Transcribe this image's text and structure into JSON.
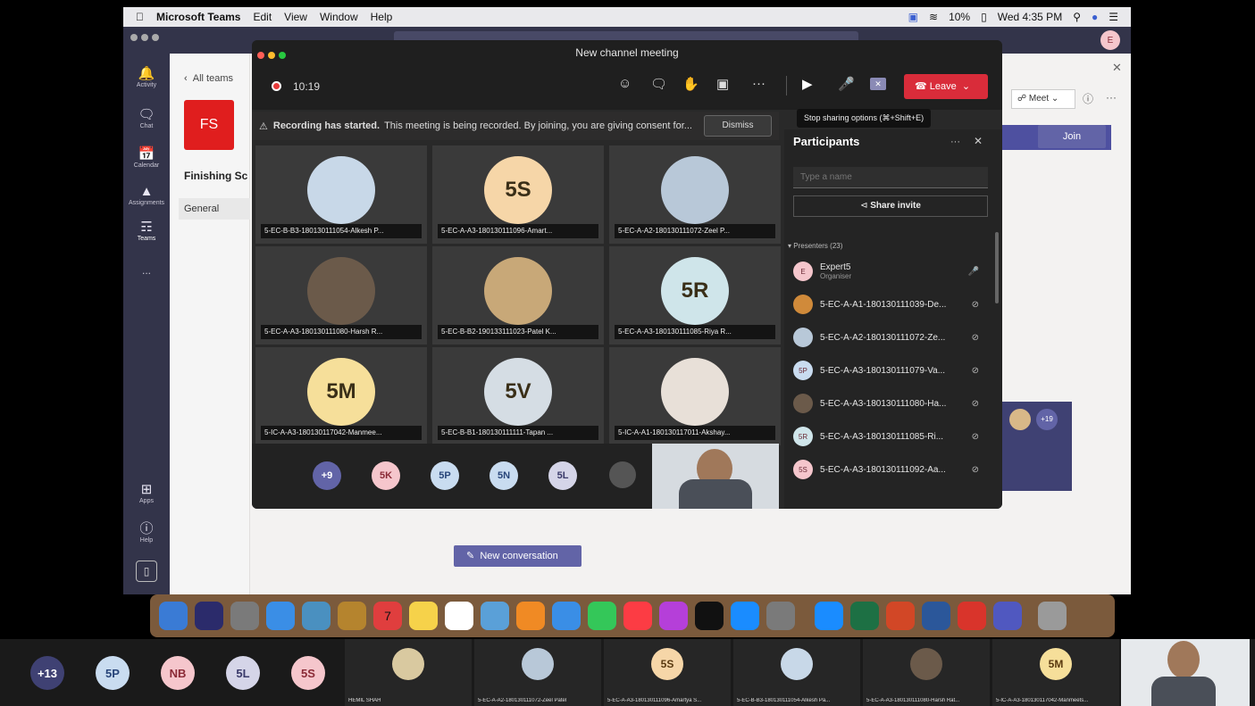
{
  "menubar": {
    "app_name": "Microsoft Teams",
    "menus": [
      "Edit",
      "View",
      "Window",
      "Help"
    ],
    "battery": "10%",
    "clock": "Wed 4:35 PM"
  },
  "rail": [
    {
      "label": "Activity",
      "icon": "bell-icon"
    },
    {
      "label": "Chat",
      "icon": "chat-icon"
    },
    {
      "label": "Calendar",
      "icon": "calendar-icon"
    },
    {
      "label": "Assignments",
      "icon": "assignments-icon"
    },
    {
      "label": "Teams",
      "icon": "teams-icon"
    },
    {
      "label": "...",
      "icon": "more-icon"
    },
    {
      "label": "Apps",
      "icon": "apps-icon"
    },
    {
      "label": "Help",
      "icon": "help-icon"
    }
  ],
  "team_panel": {
    "back_label": "All teams",
    "team_initials": "FS",
    "team_name": "Finishing Sc",
    "channel": "General",
    "meet_label": "Meet",
    "join_label": "Join",
    "new_conversation": "New conversation",
    "plus_count": "+19"
  },
  "meeting": {
    "title": "New channel meeting",
    "timer": "10:19",
    "leave_label": "Leave",
    "tooltip": "Stop sharing options (⌘+Shift+E)",
    "banner_bold": "Recording has started.",
    "banner_text": "This meeting is being recorded. By joining, you are giving consent for...",
    "dismiss_label": "Dismiss",
    "tiles": [
      {
        "name": "5-EC-B-B3-180130111054-Alkesh P...",
        "initials": "",
        "color": "#c8d8e8"
      },
      {
        "name": "5-EC-A-A3-180130111096-Amart...",
        "initials": "5S",
        "color": "#f6d6a8"
      },
      {
        "name": "5-EC-A-A2-180130111072-Zeel P...",
        "initials": "",
        "color": "#b8c8d8"
      },
      {
        "name": "5-EC-A-A3-180130111080-Harsh R...",
        "initials": "",
        "color": "#6b5a4a"
      },
      {
        "name": "5-EC-B-B2-190133111023-Patel K...",
        "initials": "",
        "color": "#c8a878"
      },
      {
        "name": "5-EC-A-A3-180130111085-Riya R...",
        "initials": "5R",
        "color": "#cfe5ea"
      },
      {
        "name": "5-IC-A-A3-180130117042-Manmee...",
        "initials": "5M",
        "color": "#f6df9a"
      },
      {
        "name": "5-EC-B-B1-180130111111-Tapan ...",
        "initials": "5V",
        "color": "#d5dde4"
      },
      {
        "name": "5-IC-A-A1-180130117011-Akshay...",
        "initials": "",
        "color": "#e8e0d8"
      }
    ],
    "bottom_chips": [
      {
        "label": "+9",
        "bg": "#6264a7",
        "fg": "#ffffff"
      },
      {
        "label": "5K",
        "bg": "#f5c6cc",
        "fg": "#8a2a36"
      },
      {
        "label": "5P",
        "bg": "#c9dcf0",
        "fg": "#28457a"
      },
      {
        "label": "5N",
        "bg": "#c9dcf0",
        "fg": "#28457a"
      },
      {
        "label": "5L",
        "bg": "#d5d5e8",
        "fg": "#3a3a6a"
      }
    ]
  },
  "participants": {
    "title": "Participants",
    "search_placeholder": "Type a name",
    "share_invite": "Share invite",
    "section": "Presenters (23)",
    "people": [
      {
        "name": "Expert5",
        "sub": "Organiser",
        "initials": "E",
        "bg": "#f5c6cc"
      },
      {
        "name": "5-EC-A-A1-180130111039-De...",
        "sub": "",
        "initials": "",
        "bg": "#d08a3a"
      },
      {
        "name": "5-EC-A-A2-180130111072-Ze...",
        "sub": "",
        "initials": "",
        "bg": "#b8c8d8"
      },
      {
        "name": "5-EC-A-A3-180130111079-Va...",
        "sub": "",
        "initials": "5P",
        "bg": "#c9dcf0"
      },
      {
        "name": "5-EC-A-A3-180130111080-Ha...",
        "sub": "",
        "initials": "",
        "bg": "#6b5a4a"
      },
      {
        "name": "5-EC-A-A3-180130111085-Ri...",
        "sub": "",
        "initials": "5R",
        "bg": "#cfe5ea"
      },
      {
        "name": "5-EC-A-A3-180130111092-Aa...",
        "sub": "",
        "initials": "5S",
        "bg": "#f5c6cc"
      }
    ]
  },
  "dock_calendar_day": "7",
  "bottom_strip": {
    "chips": [
      {
        "label": "+13",
        "bg": "#3f4173",
        "fg": "#ffffff"
      },
      {
        "label": "5P",
        "bg": "#c9dcf0",
        "fg": "#28457a"
      },
      {
        "label": "NB",
        "bg": "#f5c6cc",
        "fg": "#8a2a36"
      },
      {
        "label": "5L",
        "bg": "#d5d5e8",
        "fg": "#3a3a6a"
      },
      {
        "label": "5S",
        "bg": "#f5c6cc",
        "fg": "#8a2a36"
      }
    ],
    "tiles": [
      {
        "name": "HEMIL SHAH",
        "initials": "",
        "bg": "#d9c9a0"
      },
      {
        "name": "5-EC-A-A2-180130111072-Zeel Patel",
        "initials": "",
        "bg": "#b8c8d8"
      },
      {
        "name": "5-EC-A-A3-180130111096-Amartya S...",
        "initials": "5S",
        "bg": "#f6d6a8"
      },
      {
        "name": "5-EC-B-B3-180130111054-Alkesh Pa...",
        "initials": "",
        "bg": "#c8d8e8"
      },
      {
        "name": "5-EC-A-A3-180130111080-Harsh Rat...",
        "initials": "",
        "bg": "#6b5a4a"
      },
      {
        "name": "5-IC-A-A3-180130117042-Manmeets...",
        "initials": "5M",
        "bg": "#f6df9a"
      }
    ]
  }
}
